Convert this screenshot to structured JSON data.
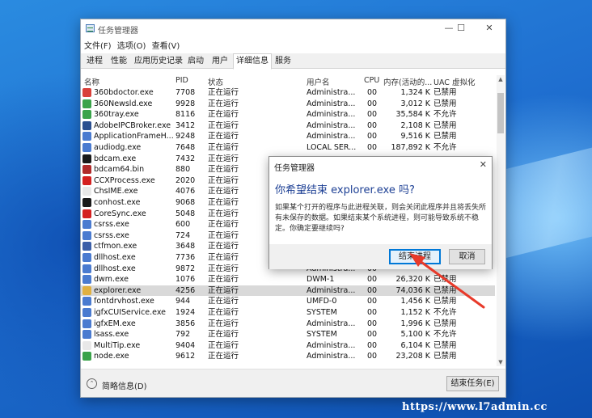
{
  "window": {
    "title": "任务管理器",
    "minimize": "—",
    "maximize": "☐",
    "close": "✕"
  },
  "menu": [
    "文件(F)",
    "选项(O)",
    "查看(V)"
  ],
  "tabs": [
    "进程",
    "性能",
    "应用历史记录",
    "启动",
    "用户",
    "详细信息",
    "服务"
  ],
  "active_tab": "详细信息",
  "columns": {
    "name": "名称",
    "pid": "PID",
    "status": "状态",
    "user": "用户名",
    "cpu": "CPU",
    "memory": "内存(活动的...",
    "uac": "UAC 虚拟化"
  },
  "processes": [
    {
      "name": "360bdoctor.exe",
      "pid": "7708",
      "status": "正在运行",
      "user": "Administra...",
      "cpu": "00",
      "mem": "1,324 K",
      "uac": "已禁用",
      "icon": "#d9403a"
    },
    {
      "name": "360Newsld.exe",
      "pid": "9928",
      "status": "正在运行",
      "user": "Administra...",
      "cpu": "00",
      "mem": "3,012 K",
      "uac": "已禁用",
      "icon": "#3aa34a"
    },
    {
      "name": "360tray.exe",
      "pid": "8116",
      "status": "正在运行",
      "user": "Administra...",
      "cpu": "00",
      "mem": "35,584 K",
      "uac": "不允许",
      "icon": "#3aa34a"
    },
    {
      "name": "AdobeIPCBroker.exe",
      "pid": "3412",
      "status": "正在运行",
      "user": "Administra...",
      "cpu": "00",
      "mem": "2,108 K",
      "uac": "已禁用",
      "icon": "#2a4f8f"
    },
    {
      "name": "ApplicationFrameH...",
      "pid": "9248",
      "status": "正在运行",
      "user": "Administra...",
      "cpu": "00",
      "mem": "9,516 K",
      "uac": "已禁用",
      "icon": "#4a7bd0"
    },
    {
      "name": "audiodg.exe",
      "pid": "7648",
      "status": "正在运行",
      "user": "LOCAL SER...",
      "cpu": "00",
      "mem": "187,892 K",
      "uac": "不允许",
      "icon": "#4a7bd0"
    },
    {
      "name": "bdcam.exe",
      "pid": "7432",
      "status": "正在运行",
      "user": "",
      "cpu": "",
      "mem": "",
      "uac": "",
      "icon": "#1a1a1a"
    },
    {
      "name": "bdcam64.bin",
      "pid": "880",
      "status": "正在运行",
      "user": "",
      "cpu": "",
      "mem": "",
      "uac": "",
      "icon": "#b02a2a"
    },
    {
      "name": "CCXProcess.exe",
      "pid": "2020",
      "status": "正在运行",
      "user": "",
      "cpu": "",
      "mem": "",
      "uac": "",
      "icon": "#d42020"
    },
    {
      "name": "ChsIME.exe",
      "pid": "4076",
      "status": "正在运行",
      "user": "",
      "cpu": "",
      "mem": "",
      "uac": "",
      "icon": "#e8e8e8"
    },
    {
      "name": "conhost.exe",
      "pid": "9068",
      "status": "正在运行",
      "user": "",
      "cpu": "",
      "mem": "",
      "uac": "",
      "icon": "#1a1a1a"
    },
    {
      "name": "CoreSync.exe",
      "pid": "5048",
      "status": "正在运行",
      "user": "",
      "cpu": "",
      "mem": "",
      "uac": "",
      "icon": "#d42020"
    },
    {
      "name": "csrss.exe",
      "pid": "600",
      "status": "正在运行",
      "user": "",
      "cpu": "",
      "mem": "",
      "uac": "",
      "icon": "#4a7bd0"
    },
    {
      "name": "csrss.exe",
      "pid": "724",
      "status": "正在运行",
      "user": "",
      "cpu": "",
      "mem": "",
      "uac": "",
      "icon": "#4a7bd0"
    },
    {
      "name": "ctfmon.exe",
      "pid": "3648",
      "status": "正在运行",
      "user": "",
      "cpu": "",
      "mem": "",
      "uac": "",
      "icon": "#3b5fa8"
    },
    {
      "name": "dllhost.exe",
      "pid": "7736",
      "status": "正在运行",
      "user": "",
      "cpu": "",
      "mem": "",
      "uac": "",
      "icon": "#4a7bd0"
    },
    {
      "name": "dllhost.exe",
      "pid": "9872",
      "status": "正在运行",
      "user": "Administra...",
      "cpu": "00",
      "mem": "",
      "uac": "",
      "icon": "#4a7bd0"
    },
    {
      "name": "dwm.exe",
      "pid": "1076",
      "status": "正在运行",
      "user": "DWM-1",
      "cpu": "00",
      "mem": "26,320 K",
      "uac": "已禁用",
      "icon": "#4a7bd0"
    },
    {
      "name": "explorer.exe",
      "pid": "4256",
      "status": "正在运行",
      "user": "Administra...",
      "cpu": "00",
      "mem": "74,036 K",
      "uac": "已禁用",
      "icon": "#e0b040"
    },
    {
      "name": "fontdrvhost.exe",
      "pid": "944",
      "status": "正在运行",
      "user": "UMFD-0",
      "cpu": "00",
      "mem": "1,456 K",
      "uac": "已禁用",
      "icon": "#4a7bd0"
    },
    {
      "name": "igfxCUIService.exe",
      "pid": "1924",
      "status": "正在运行",
      "user": "SYSTEM",
      "cpu": "00",
      "mem": "1,152 K",
      "uac": "不允许",
      "icon": "#4a7bd0"
    },
    {
      "name": "igfxEM.exe",
      "pid": "3856",
      "status": "正在运行",
      "user": "Administra...",
      "cpu": "00",
      "mem": "1,996 K",
      "uac": "已禁用",
      "icon": "#4a7bd0"
    },
    {
      "name": "lsass.exe",
      "pid": "792",
      "status": "正在运行",
      "user": "SYSTEM",
      "cpu": "00",
      "mem": "5,100 K",
      "uac": "不允许",
      "icon": "#4a7bd0"
    },
    {
      "name": "MultiTip.exe",
      "pid": "9404",
      "status": "正在运行",
      "user": "Administra...",
      "cpu": "00",
      "mem": "6,104 K",
      "uac": "已禁用",
      "icon": "#e8e8e8"
    },
    {
      "name": "node.exe",
      "pid": "9612",
      "status": "正在运行",
      "user": "Administra...",
      "cpu": "00",
      "mem": "23,208 K",
      "uac": "已禁用",
      "icon": "#3aa34a"
    }
  ],
  "selected_process": "explorer.exe",
  "footer": {
    "fewer_details": "简略信息(D)",
    "end_task": "结束任务(E)"
  },
  "dialog": {
    "title": "任务管理器",
    "close": "✕",
    "heading": "你希望结束 explorer.exe 吗?",
    "body": "如果某个打开的程序与此进程关联，则会关闭此程序并且将丢失所有未保存的数据。如果结束某个系统进程，则可能导致系统不稳定。你确定要继续吗?",
    "confirm": "结束进程",
    "cancel": "取消"
  },
  "watermark": "https://www.l7admin.cc"
}
